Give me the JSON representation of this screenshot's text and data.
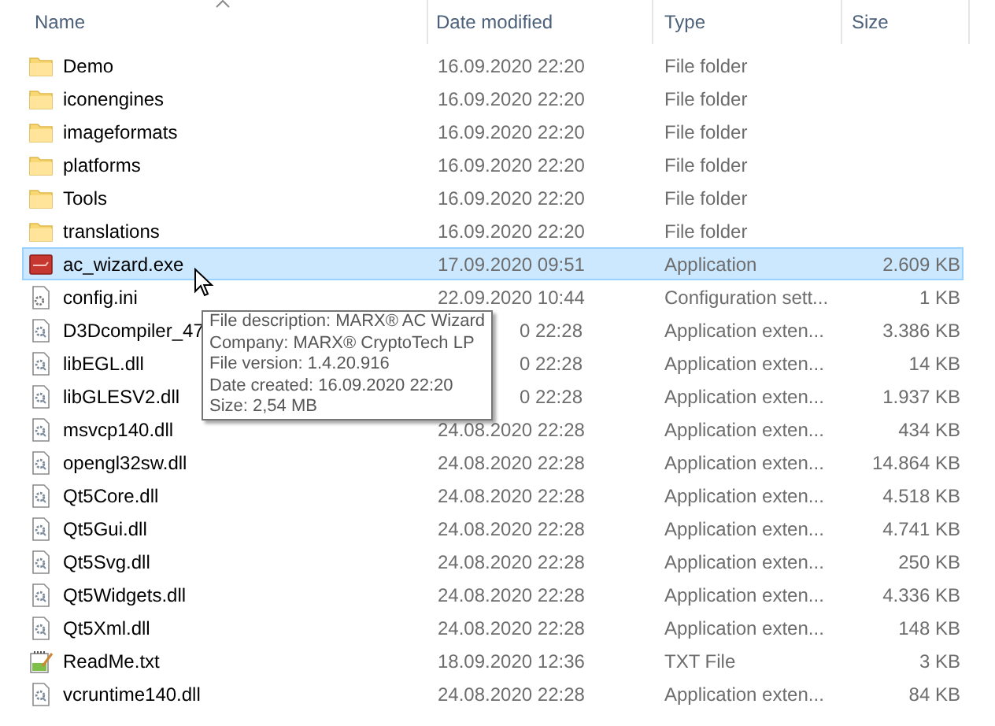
{
  "columns": [
    "Name",
    "Date modified",
    "Type",
    "Size"
  ],
  "rows": [
    {
      "kind": "folder",
      "name": "Demo",
      "date": "16.09.2020 22:20",
      "type": "File folder",
      "selected": false
    },
    {
      "kind": "folder",
      "name": "iconengines",
      "date": "16.09.2020 22:20",
      "type": "File folder",
      "selected": false
    },
    {
      "kind": "folder",
      "name": "imageformats",
      "date": "16.09.2020 22:20",
      "type": "File folder",
      "selected": false
    },
    {
      "kind": "folder",
      "name": "platforms",
      "date": "16.09.2020 22:20",
      "type": "File folder",
      "selected": false
    },
    {
      "kind": "folder",
      "name": "Tools",
      "date": "16.09.2020 22:20",
      "type": "File folder",
      "selected": false
    },
    {
      "kind": "folder",
      "name": "translations",
      "date": "16.09.2020 22:20",
      "type": "File folder",
      "selected": false
    },
    {
      "kind": "exe",
      "name": "ac_wizard.exe",
      "date": "17.09.2020 09:51",
      "type": "Application",
      "size": "2.609 KB",
      "selected": true
    },
    {
      "kind": "settings",
      "name": "config.ini",
      "date": "22.09.2020 10:44",
      "type": "Configuration sett...",
      "size": "1 KB",
      "selected": false
    },
    {
      "kind": "library",
      "name": "D3Dcompiler_47",
      "date": "0 22:28",
      "date_covered": true,
      "type": "Application exten...",
      "size": "3.386 KB",
      "selected": false
    },
    {
      "kind": "library",
      "name": "libEGL.dll",
      "date": "0 22:28",
      "date_covered": true,
      "type": "Application exten...",
      "size": "14 KB",
      "selected": false
    },
    {
      "kind": "library",
      "name": "libGLESV2.dll",
      "date": "0 22:28",
      "date_covered": true,
      "type": "Application exten...",
      "size": "1.937 KB",
      "selected": false
    },
    {
      "kind": "library",
      "name": "msvcp140.dll",
      "date": "24.08.2020 22:28",
      "type": "Application exten...",
      "size": "434 KB",
      "selected": false
    },
    {
      "kind": "library",
      "name": "opengl32sw.dll",
      "date": "24.08.2020 22:28",
      "type": "Application exten...",
      "size": "14.864 KB",
      "selected": false
    },
    {
      "kind": "library",
      "name": "Qt5Core.dll",
      "date": "24.08.2020 22:28",
      "type": "Application exten...",
      "size": "4.518 KB",
      "selected": false
    },
    {
      "kind": "library",
      "name": "Qt5Gui.dll",
      "date": "24.08.2020 22:28",
      "type": "Application exten...",
      "size": "4.741 KB",
      "selected": false
    },
    {
      "kind": "library",
      "name": "Qt5Svg.dll",
      "date": "24.08.2020 22:28",
      "type": "Application exten...",
      "size": "250 KB",
      "selected": false
    },
    {
      "kind": "library",
      "name": "Qt5Widgets.dll",
      "date": "24.08.2020 22:28",
      "type": "Application exten...",
      "size": "4.336 KB",
      "selected": false
    },
    {
      "kind": "library",
      "name": "Qt5Xml.dll",
      "date": "24.08.2020 22:28",
      "type": "Application exten...",
      "size": "148 KB",
      "selected": false
    },
    {
      "kind": "text",
      "name": "ReadMe.txt",
      "date": "18.09.2020 12:36",
      "type": "TXT File",
      "size": "3 KB",
      "selected": false
    },
    {
      "kind": "library",
      "name": "vcruntime140.dll",
      "date": "24.08.2020 22:28",
      "type": "Application exten...",
      "size": "84 KB",
      "selected": false
    }
  ],
  "tooltip": [
    "File description: MARX® AC Wizard",
    "Company: MARX® CryptoTech LP",
    "File version: 1.4.20.916",
    "Date created: 16.09.2020 22:20",
    "Size: 2,54 MB"
  ]
}
